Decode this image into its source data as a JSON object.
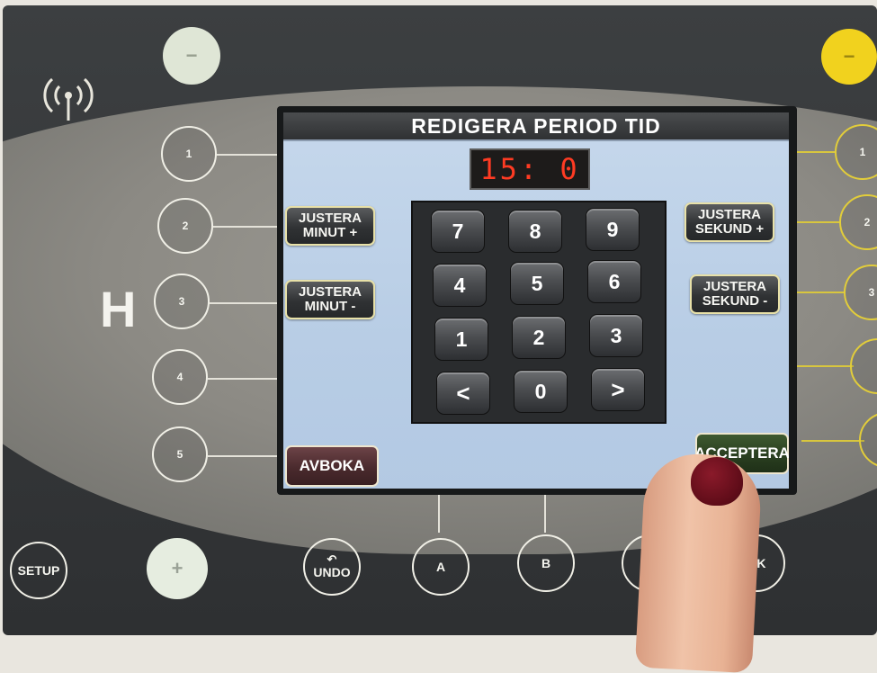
{
  "screen": {
    "title": "REDIGERA PERIOD TID",
    "time_display": "15: 0",
    "left_buttons": [
      {
        "line1": "JUSTERA",
        "line2": "MINUT +"
      },
      {
        "line1": "JUSTERA",
        "line2": "MINUT -"
      }
    ],
    "right_buttons": [
      {
        "line1": "JUSTERA",
        "line2": "SEKUND +"
      },
      {
        "line1": "JUSTERA",
        "line2": "SEKUND -"
      }
    ],
    "keypad": {
      "rows": [
        [
          "7",
          "8",
          "9"
        ],
        [
          "4",
          "5",
          "6"
        ],
        [
          "1",
          "2",
          "3"
        ],
        [
          "<",
          "0",
          ">"
        ]
      ]
    },
    "cancel_label": "AVBOKA",
    "accept_label": "ACCEPTERA"
  },
  "panel": {
    "left_numbers": [
      "1",
      "2",
      "3",
      "4",
      "5"
    ],
    "right_numbers": [
      "1",
      "2",
      "3"
    ],
    "minus_symbol": "−",
    "plus_symbol": "+",
    "logo_letter": "H",
    "bottom_buttons": [
      "SETUP",
      "UNDO",
      "A",
      "B",
      "C",
      "OK"
    ],
    "colors": {
      "minus_left": "#dfe6d6",
      "minus_right": "#f1d21e",
      "plus_left": "#e6ede0"
    }
  }
}
